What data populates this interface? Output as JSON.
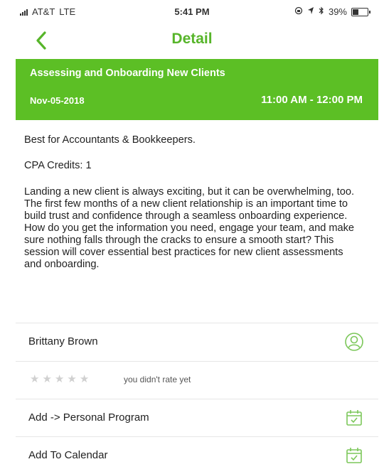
{
  "status_bar": {
    "carrier": "AT&T",
    "network": "LTE",
    "time": "5:41 PM",
    "battery": "39%",
    "battery_level": 0.39
  },
  "nav": {
    "title": "Detail",
    "back_icon": "chevron-left-icon",
    "accent_color": "#57b52a"
  },
  "event": {
    "title": "Assessing and Onboarding New Clients",
    "date": "Nov-05-2018",
    "time_range": "11:00 AM - 12:00 PM",
    "banner_color": "#5cbf25"
  },
  "details": {
    "audience": "Best for Accountants & Bookkeepers.",
    "credits": "CPA Credits: 1",
    "description": "Landing a new client is always exciting, but it can be overwhelming, too. The first few months of a new client relationship is an important time to build trust and confidence through a seamless onboarding experience. How do you get the information you need, engage your team, and make sure nothing falls through the cracks to ensure a smooth start? This session will cover essential best practices for new client assessments and onboarding."
  },
  "speaker": {
    "name": "Brittany Brown",
    "icon": "user-icon"
  },
  "rating": {
    "stars": 5,
    "value": 0,
    "text": "you didn't rate yet"
  },
  "actions": [
    {
      "label": "Add -> Personal Program",
      "icon": "calendar-check-icon"
    },
    {
      "label": "Add To Calendar",
      "icon": "calendar-check-icon"
    }
  ]
}
